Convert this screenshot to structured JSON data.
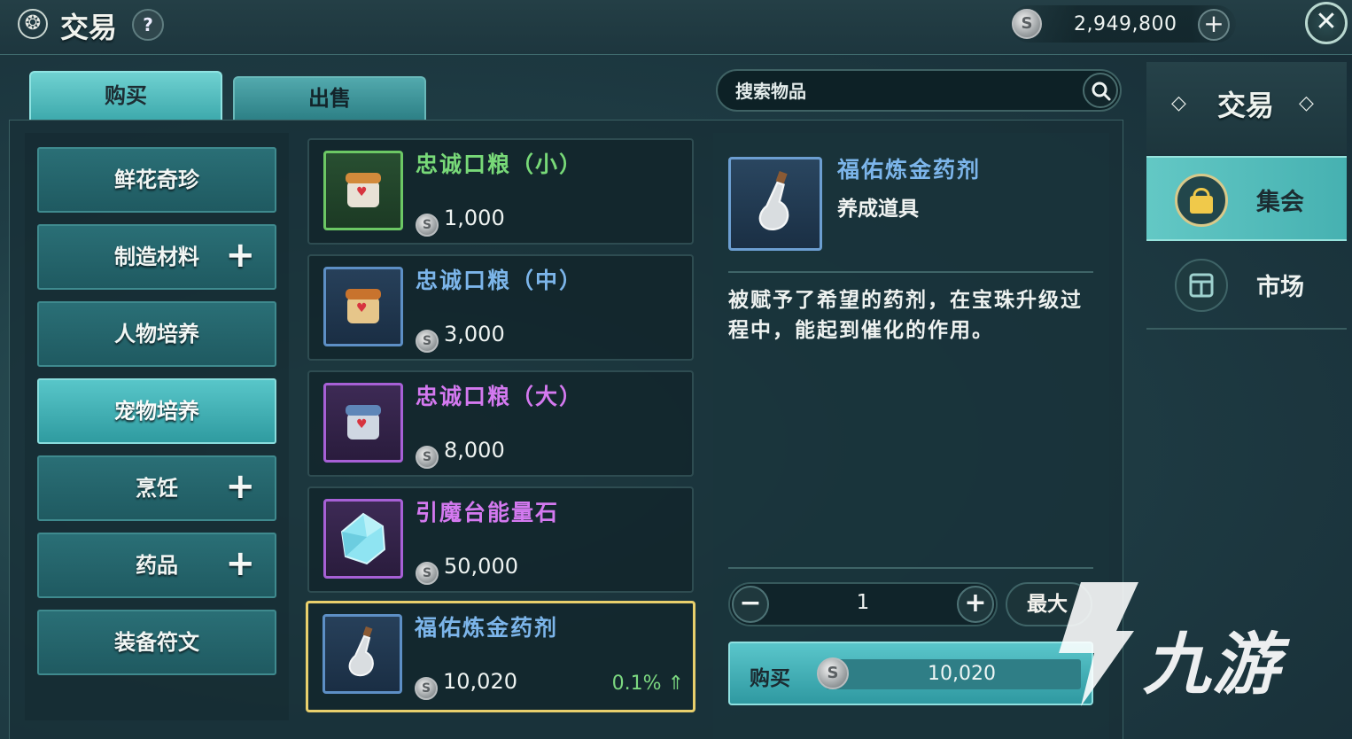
{
  "header": {
    "title": "交易",
    "help_label": "?",
    "currency_amount": "2,949,800",
    "currency_add_label": "+",
    "close_label": "✕"
  },
  "tabs": [
    {
      "label": "购买",
      "active": true
    },
    {
      "label": "出售",
      "active": false
    }
  ],
  "search": {
    "placeholder": "搜索物品"
  },
  "categories": [
    {
      "label": "鲜花奇珍",
      "expandable": false,
      "active": false
    },
    {
      "label": "制造材料",
      "expandable": true,
      "active": false
    },
    {
      "label": "人物培养",
      "expandable": false,
      "active": false
    },
    {
      "label": "宠物培养",
      "expandable": false,
      "active": true
    },
    {
      "label": "烹饪",
      "expandable": true,
      "active": false
    },
    {
      "label": "药品",
      "expandable": true,
      "active": false
    },
    {
      "label": "装备符文",
      "expandable": false,
      "active": false
    }
  ],
  "expand_symbol": "+",
  "items": [
    {
      "name": "忠诚口粮（小）",
      "price": "1,000",
      "quality": "green",
      "icon": "food-jar-small-icon"
    },
    {
      "name": "忠诚口粮（中）",
      "price": "3,000",
      "quality": "blue",
      "icon": "food-jar-medium-icon"
    },
    {
      "name": "忠诚口粮（大）",
      "price": "8,000",
      "quality": "purple",
      "icon": "food-jar-large-icon"
    },
    {
      "name": "引魔台能量石",
      "price": "50,000",
      "quality": "purple",
      "icon": "energy-crystal-icon"
    },
    {
      "name": "福佑炼金药剂",
      "price": "10,020",
      "quality": "blue",
      "icon": "potion-flask-icon",
      "change": "0.1%",
      "selected": true
    }
  ],
  "detail": {
    "name": "福佑炼金药剂",
    "type": "养成道具",
    "description": "被赋予了希望的药剂，在宝珠升级过程中，能起到催化的作用。",
    "quantity": "1",
    "minus_label": "−",
    "plus_label": "+",
    "max_label": "最大",
    "buy_label": "购买",
    "buy_price": "10,020"
  },
  "side_nav": {
    "title": "交易",
    "items": [
      {
        "label": "集会",
        "active": true,
        "icon": "bag-icon"
      },
      {
        "label": "市场",
        "active": false,
        "icon": "stall-icon"
      }
    ]
  },
  "watermark": {
    "text": "九游"
  },
  "colors": {
    "green_quality": "#78d978",
    "blue_quality": "#7cb5ea",
    "purple_quality": "#d479f0",
    "accent_teal": "#3da9ac",
    "selected_border": "#e8cf6c",
    "price_up": "#7cd880"
  }
}
